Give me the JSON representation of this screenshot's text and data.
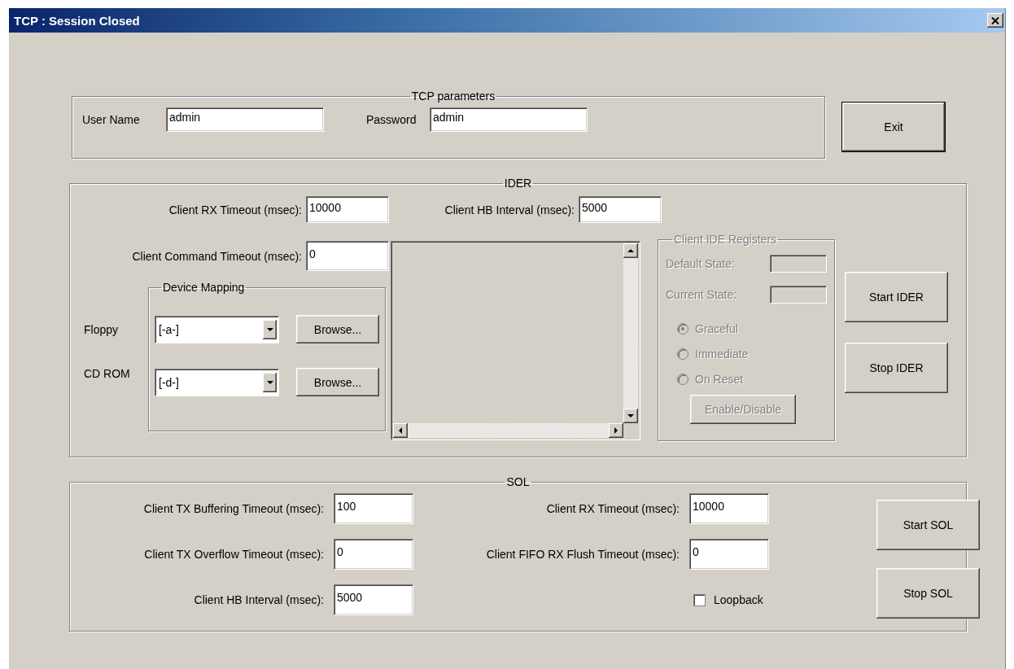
{
  "window": {
    "title": "TCP : Session Closed"
  },
  "tcp_parameters": {
    "title": "TCP parameters",
    "fields": [
      {
        "label": "User Name",
        "value": "admin"
      },
      {
        "label": "Password",
        "value": "admin"
      }
    ]
  },
  "exit_button": "Exit",
  "ider": {
    "title": "IDER",
    "client_rx_timeout": {
      "label": "Client RX Timeout (msec):",
      "value": "10000"
    },
    "client_hb_interval": {
      "label": "Client HB Interval (msec):",
      "value": "5000"
    },
    "client_command_timeout": {
      "label": "Client Command Timeout (msec):",
      "value": "0"
    },
    "device_mapping": {
      "title": "Device Mapping",
      "devices": [
        {
          "label": "Floppy",
          "value": "[-a-]",
          "button": "Browse..."
        },
        {
          "label": "CD ROM",
          "value": "[-d-]",
          "button": "Browse..."
        }
      ]
    },
    "registers": {
      "title": "Client IDE Registers",
      "disabled": true,
      "fields": [
        {
          "label": "Default State:"
        },
        {
          "label": "Current State:"
        }
      ],
      "options": [
        {
          "label": "Graceful",
          "selected": true
        },
        {
          "label": "Immediate",
          "selected": false
        },
        {
          "label": "On Reset",
          "selected": false
        }
      ],
      "button": "Enable/Disable"
    },
    "buttons": [
      "Start IDER",
      "Stop IDER"
    ]
  },
  "sol": {
    "title": "SOL",
    "fields": [
      {
        "label": "Client TX Buffering Timeout (msec):",
        "value": "100"
      },
      {
        "label": "Client RX Timeout (msec):",
        "value": "10000"
      },
      {
        "label": "Client TX Overflow Timeout (msec):",
        "value": "0"
      },
      {
        "label": "Client FIFO RX Flush Timeout (msec):",
        "value": "0"
      },
      {
        "label": "Client HB Interval (msec):",
        "value": "5000"
      }
    ],
    "loopback": {
      "label": "Loopback",
      "checked": false
    },
    "buttons": [
      "Start SOL",
      "Stop SOL"
    ]
  }
}
